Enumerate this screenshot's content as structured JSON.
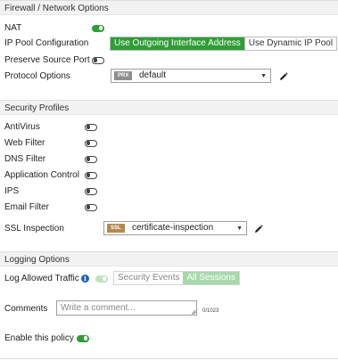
{
  "firewall": {
    "title": "Firewall / Network Options",
    "nat_label": "NAT",
    "ip_pool_label": "IP Pool Configuration",
    "ip_pool_options": [
      "Use Outgoing Interface Address",
      "Use Dynamic IP Pool"
    ],
    "ip_pool_selected": "Use Outgoing Interface Address",
    "preserve_source_port_label": "Preserve Source Port",
    "protocol_options_label": "Protocol Options",
    "protocol_badge": "PRX",
    "protocol_value": "default"
  },
  "security": {
    "title": "Security Profiles",
    "profiles": [
      {
        "label": "AntiVirus",
        "enabled": false
      },
      {
        "label": "Web Filter",
        "enabled": false
      },
      {
        "label": "DNS Filter",
        "enabled": false
      },
      {
        "label": "Application Control",
        "enabled": false
      },
      {
        "label": "IPS",
        "enabled": false
      },
      {
        "label": "Email Filter",
        "enabled": false
      }
    ],
    "ssl_label": "SSL Inspection",
    "ssl_badge": "SSL",
    "ssl_value": "certificate-inspection"
  },
  "logging": {
    "title": "Logging Options",
    "log_allowed_label": "Log Allowed Traffic",
    "log_options": [
      "Security Events",
      "All Sessions"
    ],
    "log_selected": "All Sessions"
  },
  "comments": {
    "label": "Comments",
    "placeholder": "Write a comment...",
    "counter": "0/1023"
  },
  "policy": {
    "enable_label": "Enable this policy",
    "enabled": true
  },
  "colors": {
    "accent": "#2e9e35",
    "prx_badge": "#8e8e8e",
    "ssl_badge": "#b5894f"
  }
}
